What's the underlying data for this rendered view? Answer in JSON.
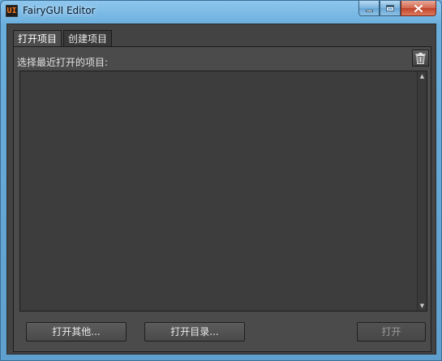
{
  "window": {
    "title": "FairyGUI Editor",
    "icon_text": "UI"
  },
  "tabs": [
    {
      "label": "打开项目",
      "active": true
    },
    {
      "label": "创建项目",
      "active": false
    }
  ],
  "open_panel": {
    "recent_label": "选择最近打开的项目:",
    "delete_icon": "trash-icon",
    "recent_projects": []
  },
  "buttons": {
    "open_other": "打开其他...",
    "open_directory": "打开目录...",
    "open": "打开"
  },
  "colors": {
    "accent_logo": "#ff7a1a",
    "panel_bg": "#4b4b4b",
    "list_bg": "#3d3d3d"
  }
}
